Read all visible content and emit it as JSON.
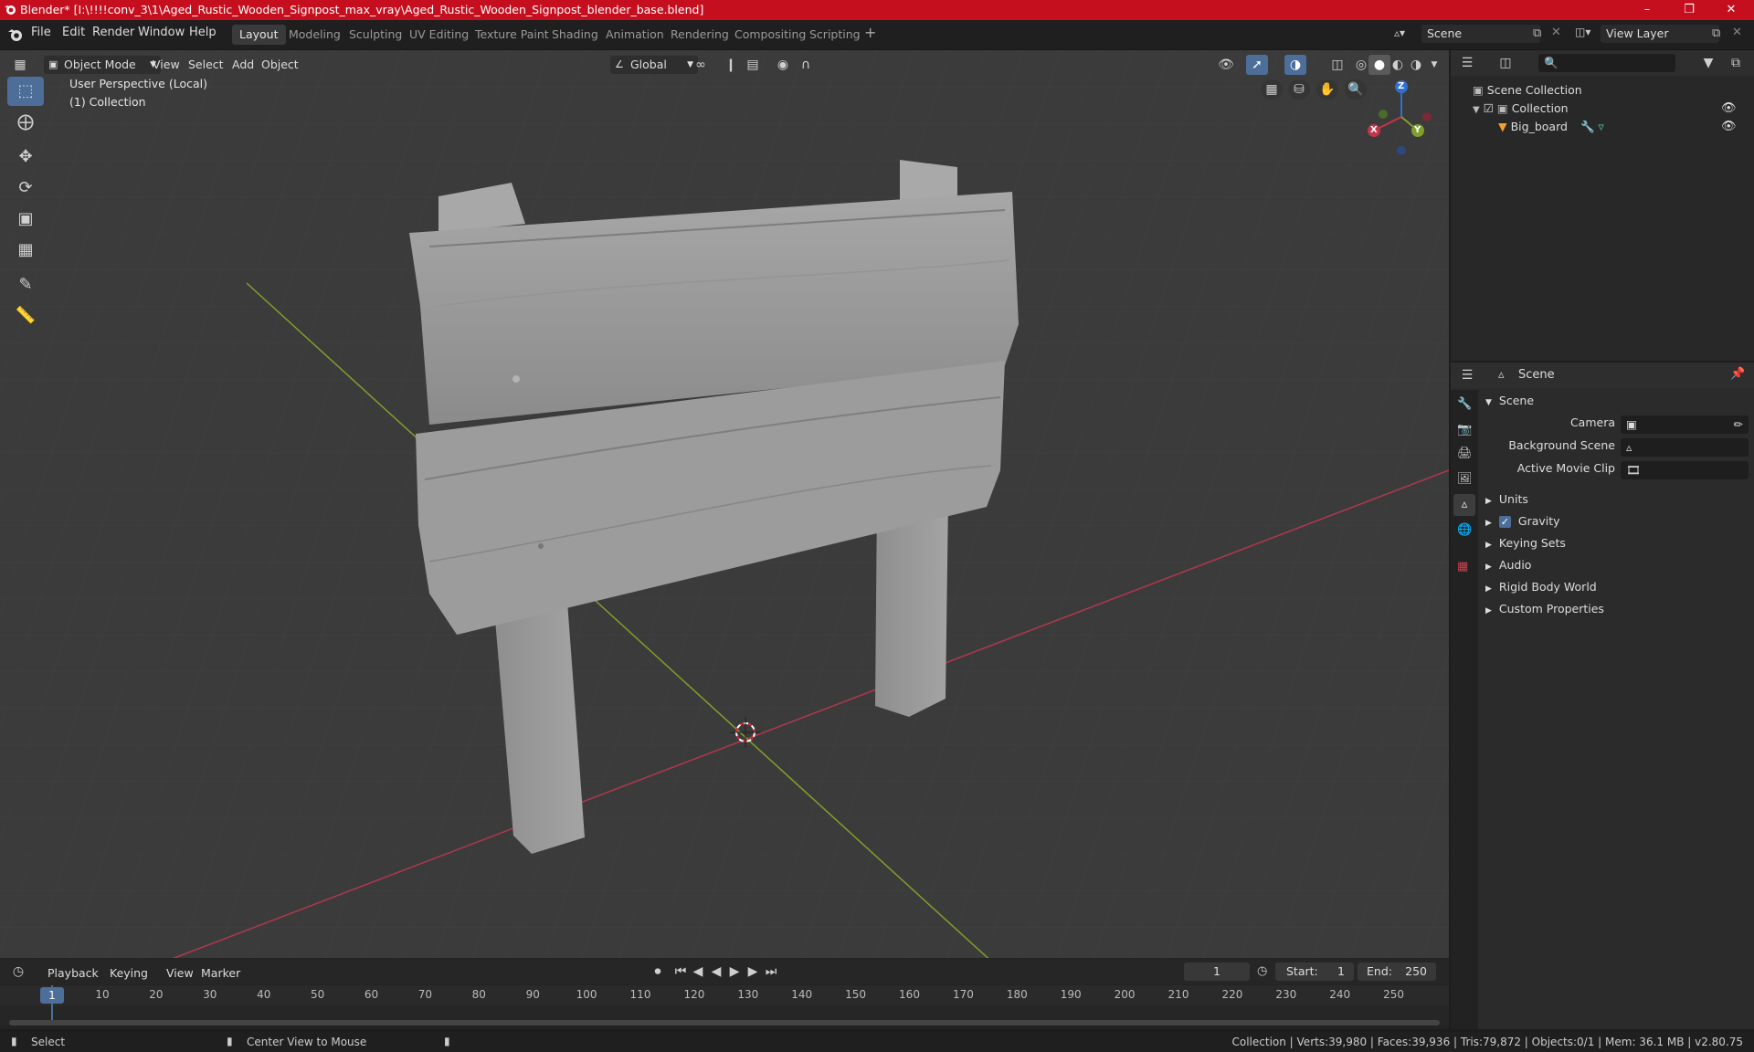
{
  "window": {
    "title": "Blender* [I:\\!!!!conv_3\\1\\Aged_Rustic_Wooden_Signpost_max_vray\\Aged_Rustic_Wooden_Signpost_blender_base.blend]"
  },
  "menu": [
    "File",
    "Edit",
    "Render",
    "Window",
    "Help"
  ],
  "workspaces": [
    "Layout",
    "Modeling",
    "Sculpting",
    "UV Editing",
    "Texture Paint",
    "Shading",
    "Animation",
    "Rendering",
    "Compositing",
    "Scripting"
  ],
  "active_workspace": "Layout",
  "scene_selector": "Scene",
  "viewlayer_selector": "View Layer",
  "viewport": {
    "mode": "Object Mode",
    "menus": [
      "View",
      "Select",
      "Add",
      "Object"
    ],
    "orientation": "Global",
    "overlay_line1": "User Perspective (Local)",
    "overlay_line2": "(1) Collection",
    "gizmo": {
      "x": "X",
      "y": "Y",
      "z": "Z"
    }
  },
  "outliner": {
    "root": "Scene Collection",
    "collection": "Collection",
    "object": "Big_board"
  },
  "properties": {
    "header": "Scene",
    "panel": "Scene",
    "camera_label": "Camera",
    "background_label": "Background Scene",
    "movieclip_label": "Active Movie Clip",
    "sections": [
      "Units",
      "Gravity",
      "Keying Sets",
      "Audio",
      "Rigid Body World",
      "Custom Properties"
    ]
  },
  "timeline": {
    "menus": [
      "Playback",
      "Keying",
      "View",
      "Marker"
    ],
    "current_frame": "1",
    "start_label": "Start:",
    "start": "1",
    "end_label": "End:",
    "end": "250",
    "ruler": [
      "1",
      "10",
      "20",
      "30",
      "40",
      "50",
      "60",
      "70",
      "80",
      "90",
      "100",
      "110",
      "120",
      "130",
      "140",
      "150",
      "160",
      "170",
      "180",
      "190",
      "200",
      "210",
      "220",
      "230",
      "240",
      "250"
    ]
  },
  "status": {
    "left": "Select",
    "middle": "Center View to Mouse",
    "right": "Collection | Verts:39,980 | Faces:39,936 | Tris:79,872 | Objects:0/1 | Mem: 36.1 MB | v2.80.75"
  },
  "colors": {
    "accent": "#4d6e99",
    "titlebar": "#c50f1f",
    "x_axis": "#c2344a",
    "y_axis": "#7fa02a"
  }
}
